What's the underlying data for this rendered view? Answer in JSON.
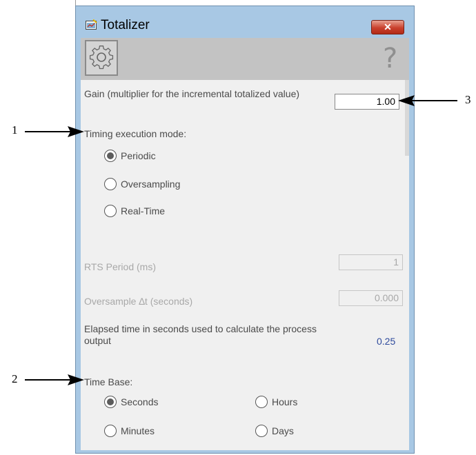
{
  "window": {
    "title": "Totalizer",
    "icon": "totalizer-app-icon",
    "close_icon": "close-icon"
  },
  "toolbar": {
    "settings_icon": "gear-icon",
    "help_icon": "question-mark-icon",
    "help_glyph": "?"
  },
  "gain": {
    "label": "Gain (multiplier for the incremental totalized value)",
    "value": "1.00"
  },
  "timing": {
    "label": "Timing execution mode:",
    "options": [
      "Periodic",
      "Oversampling",
      "Real-Time"
    ],
    "selected": "Periodic"
  },
  "rts_period": {
    "label": "RTS Period (ms)",
    "value": "1"
  },
  "oversample": {
    "label": "Oversample ∆t  (seconds)",
    "value": "0.000"
  },
  "elapsed": {
    "label": "Elapsed time in seconds used to calculate the process output",
    "value": "0.25"
  },
  "time_base": {
    "label": "Time Base:",
    "options": [
      "Seconds",
      "Hours",
      "Minutes",
      "Days"
    ],
    "selected": "Seconds"
  },
  "annotations": {
    "callout_1": "1",
    "callout_2": "2",
    "callout_3": "3"
  },
  "colors": {
    "title_bar": "#a8c8e4",
    "close_button": "#c9402d",
    "value_blue": "#2e4a9c",
    "disabled_text": "#a8a8a8"
  }
}
